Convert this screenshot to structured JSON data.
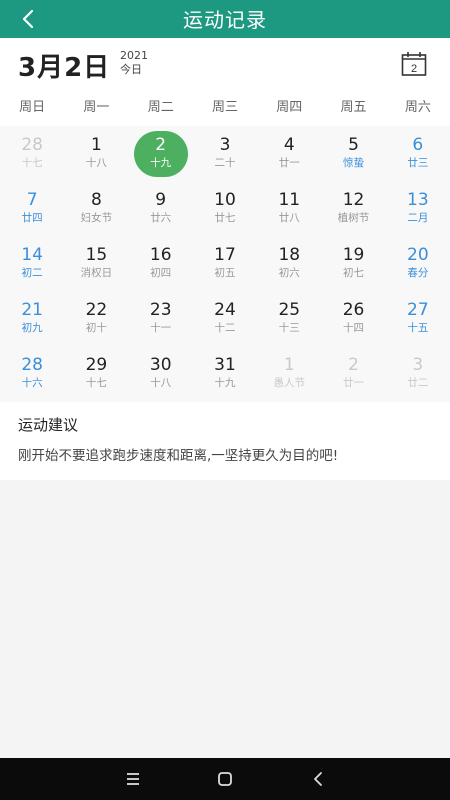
{
  "header": {
    "title": "运动记录",
    "back_icon": "chevron-left-icon"
  },
  "date_bar": {
    "big_date": "3月2日",
    "year": "2021",
    "today_label": "今日",
    "calendar_icon_day": "2"
  },
  "weekdays": [
    "周日",
    "周一",
    "周二",
    "周三",
    "周四",
    "周五",
    "周六"
  ],
  "calendar": {
    "selected_day": 2,
    "colors": {
      "accent": "#1d9982",
      "selected": "#4db060",
      "weekend": "#3a8fd9",
      "other_month": "#c9c9c9"
    },
    "rows": [
      [
        {
          "d": "28",
          "l": "十七",
          "other": true
        },
        {
          "d": "1",
          "l": "十八"
        },
        {
          "d": "2",
          "l": "十九",
          "selected": true
        },
        {
          "d": "3",
          "l": "二十"
        },
        {
          "d": "4",
          "l": "廿一"
        },
        {
          "d": "5",
          "l": "惊蛰",
          "term": true
        },
        {
          "d": "6",
          "l": "廿三"
        }
      ],
      [
        {
          "d": "7",
          "l": "廿四"
        },
        {
          "d": "8",
          "l": "妇女节"
        },
        {
          "d": "9",
          "l": "廿六"
        },
        {
          "d": "10",
          "l": "廿七"
        },
        {
          "d": "11",
          "l": "廿八"
        },
        {
          "d": "12",
          "l": "植树节"
        },
        {
          "d": "13",
          "l": "二月"
        }
      ],
      [
        {
          "d": "14",
          "l": "初二"
        },
        {
          "d": "15",
          "l": "消权日"
        },
        {
          "d": "16",
          "l": "初四"
        },
        {
          "d": "17",
          "l": "初五"
        },
        {
          "d": "18",
          "l": "初六"
        },
        {
          "d": "19",
          "l": "初七"
        },
        {
          "d": "20",
          "l": "春分"
        }
      ],
      [
        {
          "d": "21",
          "l": "初九"
        },
        {
          "d": "22",
          "l": "初十"
        },
        {
          "d": "23",
          "l": "十一"
        },
        {
          "d": "24",
          "l": "十二"
        },
        {
          "d": "25",
          "l": "十三"
        },
        {
          "d": "26",
          "l": "十四"
        },
        {
          "d": "27",
          "l": "十五"
        }
      ],
      [
        {
          "d": "28",
          "l": "十六"
        },
        {
          "d": "29",
          "l": "十七"
        },
        {
          "d": "30",
          "l": "十八"
        },
        {
          "d": "31",
          "l": "十九"
        },
        {
          "d": "1",
          "l": "愚人节",
          "other": true
        },
        {
          "d": "2",
          "l": "廿一",
          "other": true
        },
        {
          "d": "3",
          "l": "廿二",
          "other": true
        }
      ]
    ]
  },
  "advice": {
    "heading": "运动建议",
    "text": "刚开始不要追求跑步速度和距离,一坚持更久为目的吧!"
  },
  "nav_bar": {
    "icons": [
      "menu-icon",
      "home-icon",
      "back-icon"
    ]
  }
}
